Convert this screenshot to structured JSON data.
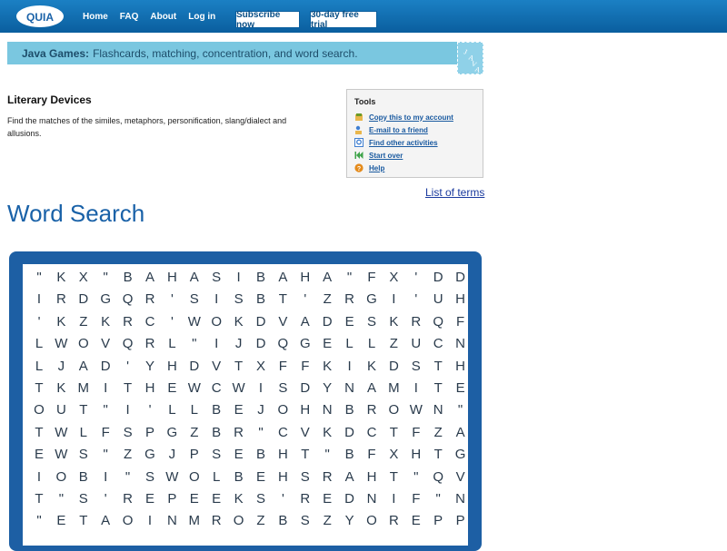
{
  "brand": {
    "logo_text": "QUIA"
  },
  "nav": {
    "home": "Home",
    "faq": "FAQ",
    "about": "About",
    "login": "Log in",
    "subscribe": "Subscribe now",
    "trial": "30-day free trial"
  },
  "banner": {
    "bold": "Java Games:",
    "text": "Flashcards, matching, concentration, and word search.",
    "badge": "JAVA"
  },
  "activity": {
    "title": "Literary Devices",
    "description": "Find the matches of the similes, metaphors, personification, slang/dialect and allusions."
  },
  "tools": {
    "heading": "Tools",
    "items": [
      {
        "label": "Copy this to my account",
        "icon": "copy-icon",
        "color": "#e9b64b"
      },
      {
        "label": "E-mail to a friend",
        "icon": "email-icon",
        "color": "#3f7fd1"
      },
      {
        "label": "Find other activities",
        "icon": "find-icon",
        "color": "#3f7fd1"
      },
      {
        "label": "Start over",
        "icon": "rewind-icon",
        "color": "#3fa34a"
      },
      {
        "label": "Help",
        "icon": "help-icon",
        "color": "#e48a1a"
      }
    ]
  },
  "links": {
    "list_of_terms": "List of terms"
  },
  "word_search": {
    "title": "Word Search",
    "rows": [
      "\"KX\"BAHASIBAHA\"FX'DD",
      "IRDGQR'SISBT'ZRGI'UH",
      "'KZKRC'WOKDVADESKRQF",
      "LWOVQRL\"IJDQGELLZUCN",
      "LJAD'YHDVTXFFKIKDSTH",
      "TKMITHEWCWISDYNAMITE",
      "OUT\"I'LLBEJOHNBROWN\"",
      "TWLFSPGZBR\"CVKDCTFZA",
      "EWS\"ZGJPSEBHT\"BFXHTG",
      "IOBI\"SWOLBEHSRAHT\"QV",
      "T\"S'REPEEKS'REDNIF\"N",
      "\"ETAOINMROZBSZYOREPP"
    ]
  }
}
